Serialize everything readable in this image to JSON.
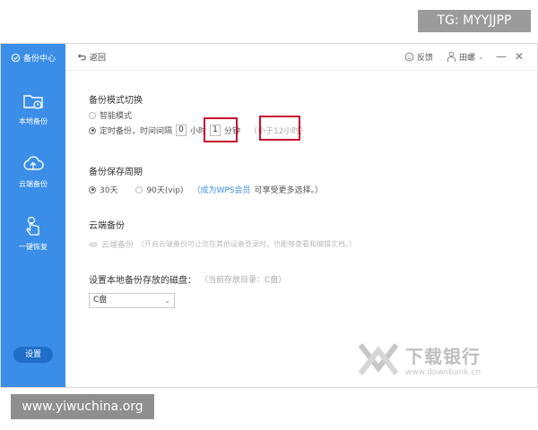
{
  "overlay": {
    "tg_label": "TG: MYYJJPP",
    "site_label": "www.yiwuchina.org"
  },
  "sidebar": {
    "title": "备份中心",
    "items": [
      {
        "label": "本地备份",
        "icon": "local-folder-icon"
      },
      {
        "label": "云端备份",
        "icon": "cloud-upload-icon"
      },
      {
        "label": "一键恢复",
        "icon": "hand-tap-icon"
      }
    ],
    "settings_label": "设置"
  },
  "topbar": {
    "back_label": "返回",
    "feedback_label": "反馈",
    "user_name": "田螺",
    "colors": {
      "accent": "#3a8ee8"
    }
  },
  "backup_mode": {
    "title": "备份模式切换",
    "smart_label": "智能模式",
    "timed_label": "定时备份，时间间隔",
    "hours_value": "0",
    "hours_unit": "小时",
    "minutes_value": "1",
    "minutes_unit": "分钟",
    "range_hint": "（小于12小时）"
  },
  "retention": {
    "title": "备份保存周期",
    "opt_30": "30天",
    "opt_90": "90天(vip)",
    "member_link": "（成为WPS会员",
    "member_suffix": "可享受更多选择。）"
  },
  "cloud_backup": {
    "title": "云端备份",
    "toggle_label": "云端备份",
    "description": "（开启云端备份可让您在其他设备登录时，也能够查看和编辑文档。）"
  },
  "local_disk": {
    "title": "设置本地备份存放的磁盘：",
    "current_hint": "（当前存放目录：C盘）",
    "selected": "C盘"
  },
  "watermark": {
    "cn": "下载银行",
    "url": "www.downbank.cn"
  }
}
